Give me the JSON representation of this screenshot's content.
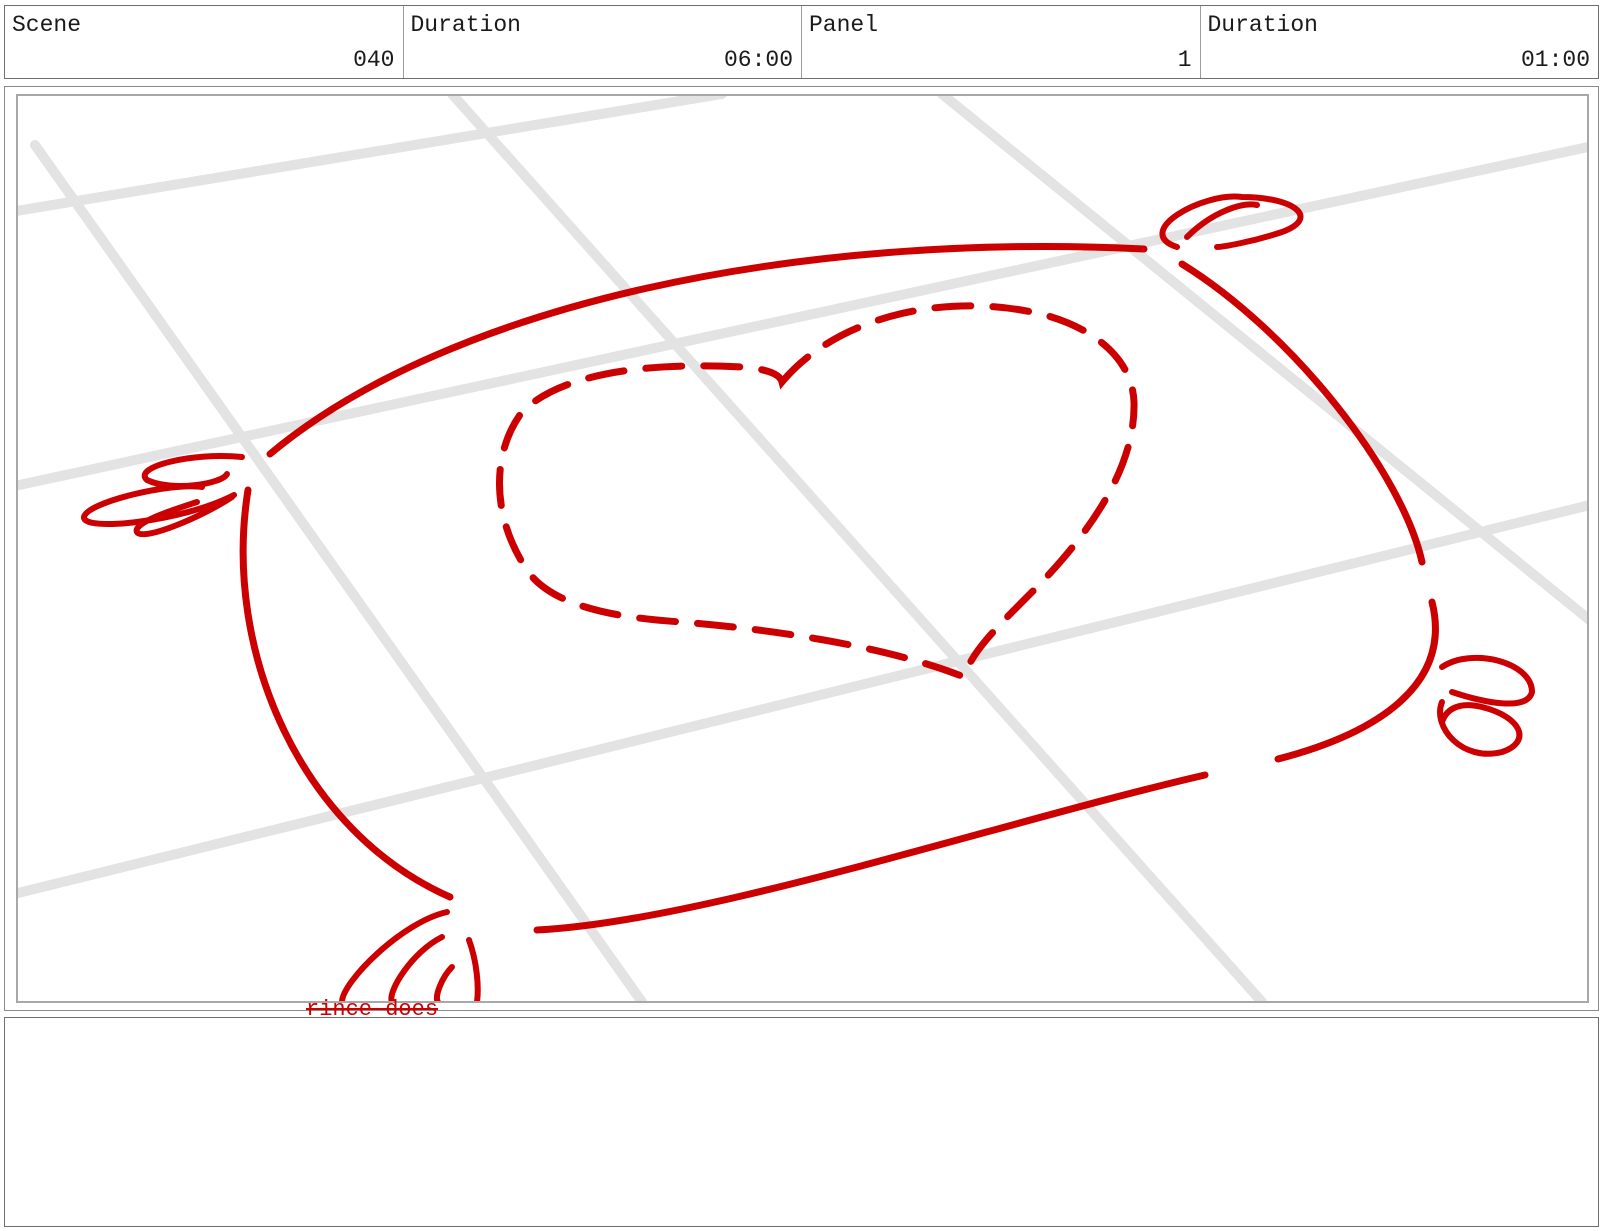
{
  "header": {
    "cells": [
      {
        "label": "Scene",
        "value": "040"
      },
      {
        "label": "Duration",
        "value": "06:00"
      },
      {
        "label": "Panel",
        "value": "1"
      },
      {
        "label": "Duration",
        "value": "01:00"
      }
    ]
  },
  "panel": {
    "caption": "rince does",
    "stroke_color": "#cc0000",
    "grid_color": "#e3e3e3"
  },
  "notes": {
    "text": ""
  }
}
